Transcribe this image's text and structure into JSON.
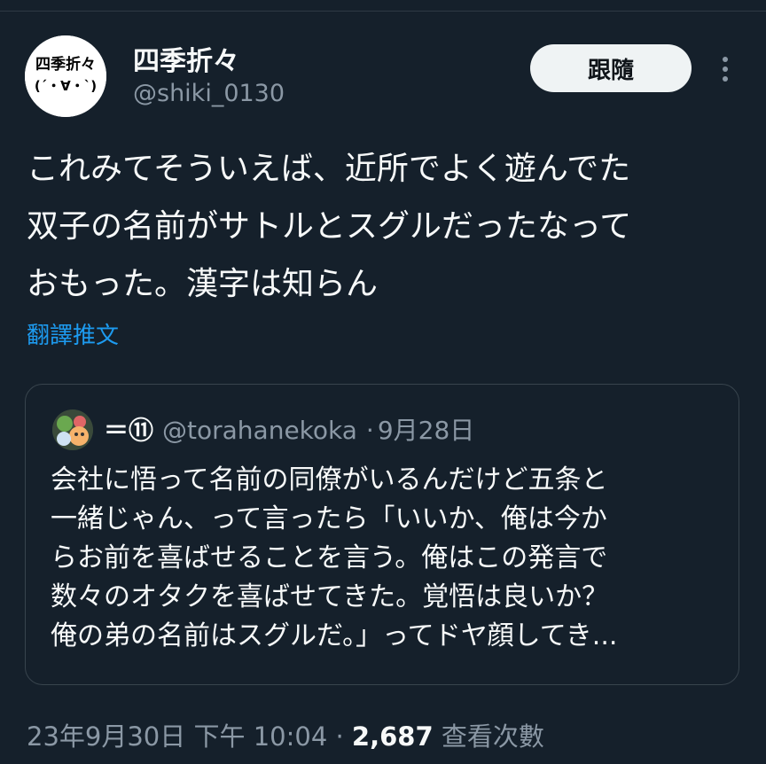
{
  "author": {
    "display_name": "四季折々",
    "handle": "@shiki_0130",
    "avatar_text": "四季折々",
    "avatar_face": "(´・∀・`)"
  },
  "actions": {
    "follow_label": "跟隨",
    "more_icon": "more-vertical-icon"
  },
  "tweet": {
    "lines": [
      "これみてそういえば、近所でよく遊んでた",
      "双子の名前がサトルとスグルだったなって",
      "おもった。漢字は知らん"
    ],
    "translate_label": "翻譯推文"
  },
  "quote": {
    "name": "＝⑪",
    "handle": "@torahanekoka",
    "separator": "·",
    "date": "9月28日",
    "lines": [
      "会社に悟って名前の同僚がいるんだけど五条と",
      "一緒じゃん、って言ったら「いいか、俺は今か",
      "らお前を喜ばせることを言う。俺はこの発言で",
      "数々のオタクを喜ばせてきた。覚悟は良いか？",
      "俺の弟の名前はスグルだ。」ってドヤ顔してき..."
    ]
  },
  "meta": {
    "timestamp": "23年9月30日 下午 10:04",
    "separator": "·",
    "views_count": "2,687",
    "views_label": "查看次數"
  },
  "colors": {
    "background": "#15202b",
    "text": "#f7f9f9",
    "muted": "#8b98a5",
    "link": "#1d9bf0",
    "border": "#38444d"
  }
}
